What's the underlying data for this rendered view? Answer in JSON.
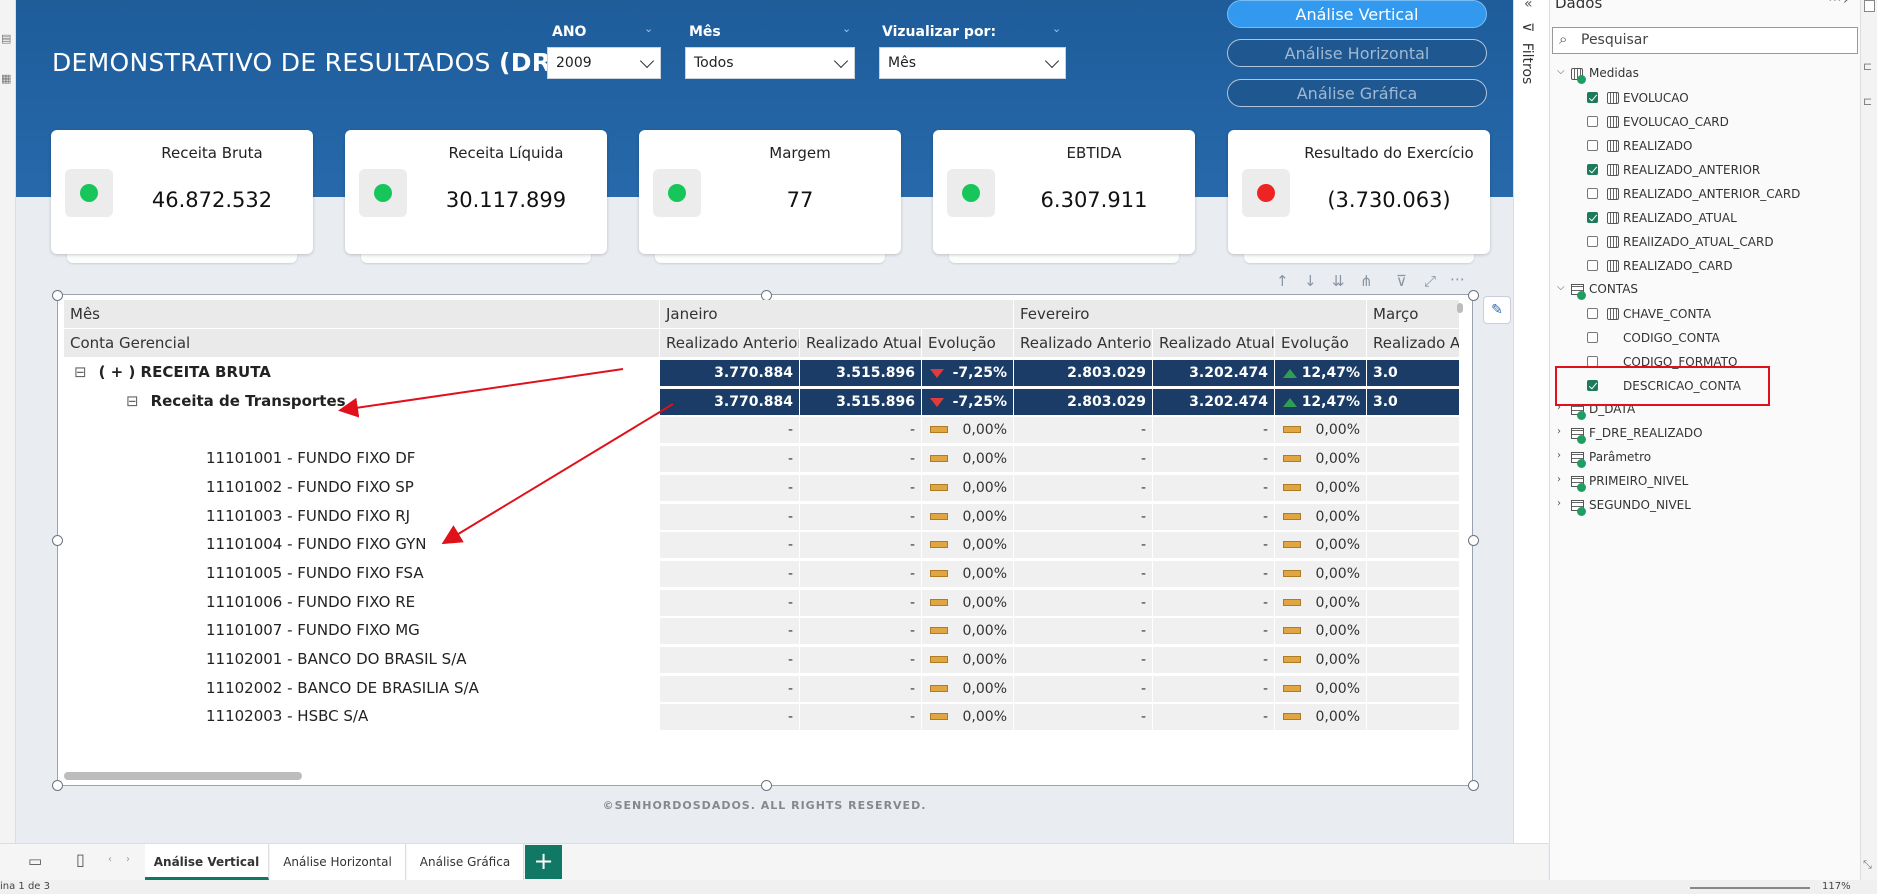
{
  "report": {
    "title_main": "DEMONSTRATIVO DE RESULTADOS ",
    "title_bold": "(DRE)",
    "filters": [
      {
        "label": "ANO",
        "value": "2009"
      },
      {
        "label": "Mês",
        "value": "Todos"
      },
      {
        "label": "Vizualizar por:",
        "value": "Mês"
      }
    ],
    "nav": [
      "Análise Vertical",
      "Análise Horizontal",
      "Análise Gráfica"
    ],
    "cards": [
      {
        "title": "Receita Bruta",
        "value": "46.872.532",
        "status": "green"
      },
      {
        "title": "Receita Líquida",
        "value": "30.117.899",
        "status": "green"
      },
      {
        "title": "Margem",
        "value": "77",
        "status": "green"
      },
      {
        "title": "EBTIDA",
        "value": "6.307.911",
        "status": "green"
      },
      {
        "title": "Resultado do Exercício",
        "value": "(3.730.063)",
        "status": "red"
      }
    ],
    "colors": {
      "green": "#16c65a",
      "red": "#ee2424",
      "dark_row": "#1a3c66",
      "header": "#2769ab"
    },
    "footer": "©SENHORDOSDADOS. ALL RIGHTS RESERVED."
  },
  "matrix": {
    "row_header_1": "Mês",
    "row_header_2": "Conta Gerencial",
    "months": [
      "Janeiro",
      "Fevereiro",
      "Março"
    ],
    "measures": [
      "Realizado Anterior",
      "Realizado Atual",
      "Evolução"
    ],
    "measure_cutoff": "Realizado A",
    "rows": [
      {
        "label": "( + ) RECEITA BRUTA",
        "toggle": "⊟",
        "level": 0,
        "style": "dark",
        "jan": [
          "3.770.884",
          "3.515.896",
          "-7,25%",
          "down"
        ],
        "fev": [
          "2.803.029",
          "3.202.474",
          "12,47%",
          "up"
        ],
        "mar": "3.0"
      },
      {
        "label": "Receita de Transportes",
        "toggle": "⊟",
        "level": 1,
        "style": "dark",
        "jan": [
          "3.770.884",
          "3.515.896",
          "-7,25%",
          "down"
        ],
        "fev": [
          "2.803.029",
          "3.202.474",
          "12,47%",
          "up"
        ],
        "mar": "3.0"
      },
      {
        "label": "",
        "level": 2,
        "style": "light",
        "jan": [
          "-",
          "-",
          "0,00%",
          "flat"
        ],
        "fev": [
          "-",
          "-",
          "0,00%",
          "flat"
        ],
        "mar": ""
      },
      {
        "label": "11101001 - FUNDO FIXO DF",
        "level": 2,
        "style": "light",
        "jan": [
          "-",
          "-",
          "0,00%",
          "flat"
        ],
        "fev": [
          "-",
          "-",
          "0,00%",
          "flat"
        ],
        "mar": ""
      },
      {
        "label": "11101002 - FUNDO FIXO SP",
        "level": 2,
        "style": "light",
        "jan": [
          "-",
          "-",
          "0,00%",
          "flat"
        ],
        "fev": [
          "-",
          "-",
          "0,00%",
          "flat"
        ],
        "mar": ""
      },
      {
        "label": "11101003 - FUNDO FIXO RJ",
        "level": 2,
        "style": "light",
        "jan": [
          "-",
          "-",
          "0,00%",
          "flat"
        ],
        "fev": [
          "-",
          "-",
          "0,00%",
          "flat"
        ],
        "mar": ""
      },
      {
        "label": "11101004 - FUNDO FIXO GYN",
        "level": 2,
        "style": "light",
        "jan": [
          "-",
          "-",
          "0,00%",
          "flat"
        ],
        "fev": [
          "-",
          "-",
          "0,00%",
          "flat"
        ],
        "mar": ""
      },
      {
        "label": "11101005 - FUNDO FIXO FSA",
        "level": 2,
        "style": "light",
        "jan": [
          "-",
          "-",
          "0,00%",
          "flat"
        ],
        "fev": [
          "-",
          "-",
          "0,00%",
          "flat"
        ],
        "mar": ""
      },
      {
        "label": "11101006 - FUNDO FIXO RE",
        "level": 2,
        "style": "light",
        "jan": [
          "-",
          "-",
          "0,00%",
          "flat"
        ],
        "fev": [
          "-",
          "-",
          "0,00%",
          "flat"
        ],
        "mar": ""
      },
      {
        "label": "11101007 - FUNDO FIXO MG",
        "level": 2,
        "style": "light",
        "jan": [
          "-",
          "-",
          "0,00%",
          "flat"
        ],
        "fev": [
          "-",
          "-",
          "0,00%",
          "flat"
        ],
        "mar": ""
      },
      {
        "label": "11102001 - BANCO DO BRASIL S/A",
        "level": 2,
        "style": "light",
        "jan": [
          "-",
          "-",
          "0,00%",
          "flat"
        ],
        "fev": [
          "-",
          "-",
          "0,00%",
          "flat"
        ],
        "mar": ""
      },
      {
        "label": "11102002 - BANCO DE BRASILIA S/A",
        "level": 2,
        "style": "light",
        "jan": [
          "-",
          "-",
          "0,00%",
          "flat"
        ],
        "fev": [
          "-",
          "-",
          "0,00%",
          "flat"
        ],
        "mar": ""
      },
      {
        "label": "11102003 - HSBC S/A",
        "level": 2,
        "style": "light",
        "jan": [
          "-",
          "-",
          "0,00%",
          "flat"
        ],
        "fev": [
          "-",
          "-",
          "0,00%",
          "flat"
        ],
        "mar": ""
      }
    ]
  },
  "filters_pane": {
    "label": "Filtros"
  },
  "data_pane": {
    "title": "Dados",
    "search_placeholder": "Pesquisar",
    "tree": [
      {
        "name": "Medidas",
        "type": "group",
        "expanded": true,
        "children": [
          {
            "name": "EVOLUCAO",
            "checked": true,
            "icon": "calc"
          },
          {
            "name": "EVOLUCAO_CARD",
            "checked": false,
            "icon": "calc"
          },
          {
            "name": "REALIZADO",
            "checked": false,
            "icon": "calc"
          },
          {
            "name": "REALIZADO_ANTERIOR",
            "checked": true,
            "icon": "calc"
          },
          {
            "name": "REALIZADO_ANTERIOR_CARD",
            "checked": false,
            "icon": "calc"
          },
          {
            "name": "REALIZADO_ATUAL",
            "checked": true,
            "icon": "calc"
          },
          {
            "name": "REAlIZADO_ATUAL_CARD",
            "checked": false,
            "icon": "calc"
          },
          {
            "name": "REALIZADO_CARD",
            "checked": false,
            "icon": "calc"
          }
        ]
      },
      {
        "name": "CONTAS",
        "type": "table",
        "expanded": true,
        "children": [
          {
            "name": "CHAVE_CONTA",
            "checked": false,
            "icon": "key"
          },
          {
            "name": "CODIGO_CONTA",
            "checked": false,
            "icon": ""
          },
          {
            "name": "CODIGO_FORMATO",
            "checked": false,
            "icon": ""
          },
          {
            "name": "DESCRICAO_CONTA",
            "checked": true,
            "icon": ""
          }
        ]
      },
      {
        "name": "D_DATA",
        "type": "table",
        "expanded": false
      },
      {
        "name": "F_DRE_REALIZADO",
        "type": "table",
        "expanded": false
      },
      {
        "name": "Parâmetro",
        "type": "table",
        "expanded": false
      },
      {
        "name": "PRIMEIRO_NIVEL",
        "type": "table",
        "expanded": false
      },
      {
        "name": "SEGUNDO_NIVEL",
        "type": "table",
        "expanded": false
      }
    ]
  },
  "page_tabs": [
    "Análise Vertical",
    "Análise Horizontal",
    "Análise Gráfica"
  ],
  "status": {
    "page": "ina 1 de 3",
    "zoom": "117%"
  }
}
